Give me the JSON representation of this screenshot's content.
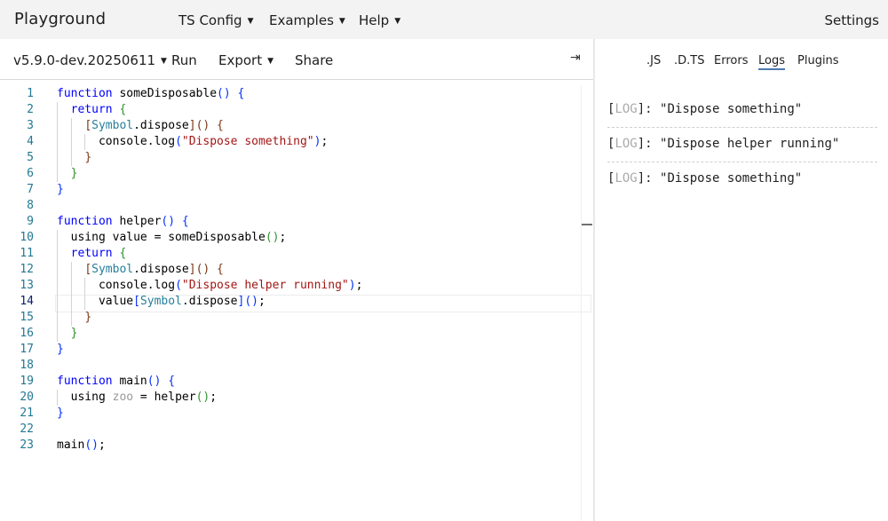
{
  "topnav": {
    "brand": "Playground",
    "items": [
      {
        "label": "TS Config"
      },
      {
        "label": "Examples"
      },
      {
        "label": "Help"
      }
    ],
    "settings": "Settings",
    "caret": "▼"
  },
  "toolbar": {
    "version": "v5.9.0-dev.20250611",
    "run": "Run",
    "export": "Export",
    "share": "Share",
    "collapse_glyph": "⇥"
  },
  "editor": {
    "line_numbers": [
      "1",
      "2",
      "3",
      "4",
      "5",
      "6",
      "7",
      "8",
      "9",
      "10",
      "11",
      "12",
      "13",
      "14",
      "15",
      "16",
      "17",
      "18",
      "19",
      "20",
      "21",
      "22",
      "23"
    ],
    "current_line": 14,
    "lines": [
      "function someDisposable() {",
      "  return {",
      "    [Symbol.dispose]() {",
      "      console.log(\"Dispose something\");",
      "    }",
      "  }",
      "}",
      "",
      "function helper() {",
      "  using value = someDisposable();",
      "  return {",
      "    [Symbol.dispose]() {",
      "      console.log(\"Dispose helper running\");",
      "      value[Symbol.dispose]();",
      "    }",
      "  }",
      "}",
      "",
      "function main() {",
      "  using zoo = helper();",
      "}",
      "",
      "main();"
    ]
  },
  "right_panel": {
    "tabs": [
      {
        "label": ".JS",
        "active": false
      },
      {
        "label": ".D.TS",
        "active": false
      },
      {
        "label": "Errors",
        "active": false
      },
      {
        "label": "Logs",
        "active": true
      },
      {
        "label": "Plugins",
        "active": false
      }
    ],
    "logs": [
      {
        "tag": "LOG",
        "message": "\"Dispose something\""
      },
      {
        "tag": "LOG",
        "message": "\"Dispose helper running\""
      },
      {
        "tag": "LOG",
        "message": "\"Dispose something\""
      }
    ]
  },
  "colors": {
    "keyword": "#0000ff",
    "string": "#a31515",
    "line_number": "#237893",
    "active_tab_underline": "#4c7aaf",
    "topnav_bg": "#f3f3f3"
  }
}
